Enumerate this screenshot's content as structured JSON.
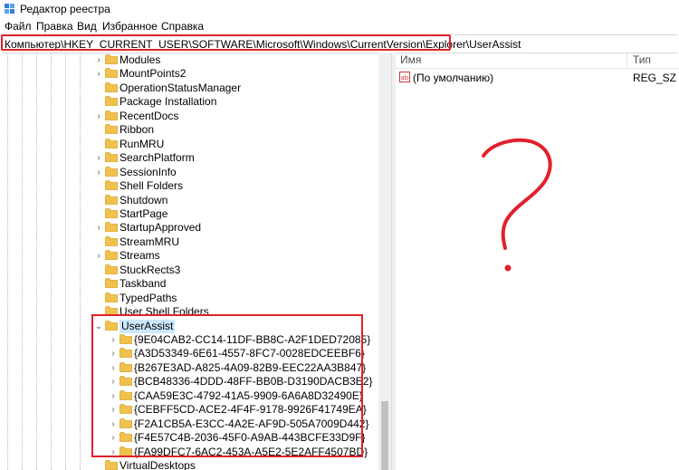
{
  "window": {
    "title": "Редактор реестра",
    "icon": "regedit-icon"
  },
  "menu": {
    "items": [
      "Файл",
      "Правка",
      "Вид",
      "Избранное",
      "Справка"
    ]
  },
  "address": {
    "path": "Компьютер\\HKEY_CURRENT_USER\\SOFTWARE\\Microsoft\\Windows\\CurrentVersion\\Explorer\\UserAssist"
  },
  "tree": {
    "explorer_children_before": [
      "Modules",
      "MountPoints2",
      "OperationStatusManager",
      "Package Installation",
      "RecentDocs",
      "Ribbon",
      "RunMRU",
      "SearchPlatform",
      "SessionInfo",
      "Shell Folders",
      "Shutdown",
      "StartPage",
      "StartupApproved",
      "StreamMRU",
      "Streams",
      "StuckRects3",
      "Taskband",
      "TypedPaths",
      "User Shell Folders"
    ],
    "expanded_flags": [
      true,
      true,
      false,
      false,
      true,
      false,
      false,
      true,
      true,
      false,
      false,
      false,
      true,
      false,
      true,
      false,
      false,
      false,
      false
    ],
    "selected": "UserAssist",
    "userassist_children": [
      "{9E04CAB2-CC14-11DF-BB8C-A2F1DED72085}",
      "{A3D53349-6E61-4557-8FC7-0028EDCEEBF6}",
      "{B267E3AD-A825-4A09-82B9-EEC22AA3B847}",
      "{BCB48336-4DDD-48FF-BB0B-D3190DACB3E2}",
      "{CAA59E3C-4792-41A5-9909-6A6A8D32490E}",
      "{CEBFF5CD-ACE2-4F4F-9178-9926F41749EA}",
      "{F2A1CB5A-E3CC-4A2E-AF9D-505A7009D442}",
      "{F4E57C4B-2036-45F0-A9AB-443BCFE33D9F}",
      "{FA99DFC7-6AC2-453A-A5E2-5E2AFF4507BD}"
    ],
    "after": [
      "VirtualDesktops"
    ]
  },
  "values": {
    "headers": {
      "name": "Имя",
      "type": "Тип"
    },
    "rows": [
      {
        "icon": "string-value-icon",
        "name": "(По умолчанию)",
        "type": "REG_SZ"
      }
    ]
  },
  "colors": {
    "annotation": "#e0212b",
    "selection": "#cce8ff",
    "folder": "#f0c24d"
  }
}
